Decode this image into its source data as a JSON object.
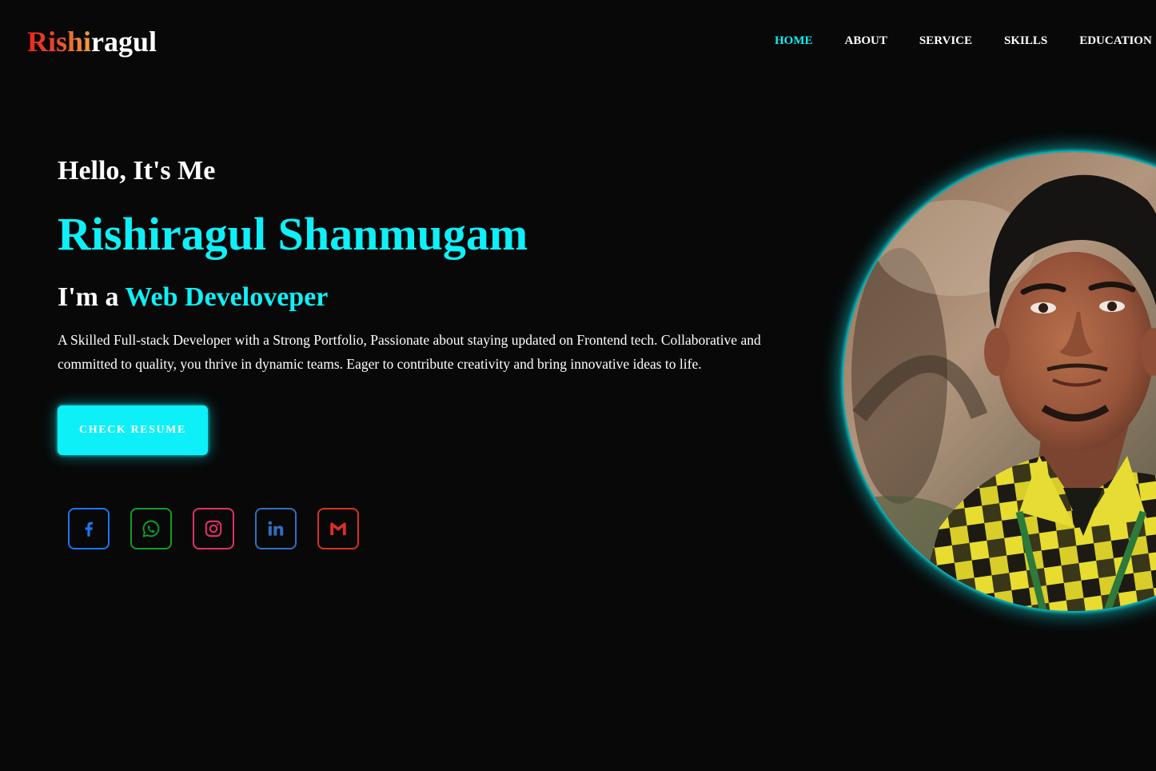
{
  "header": {
    "logo_first": "Rishi",
    "logo_second": "ragul",
    "nav": [
      "HOME",
      "ABOUT",
      "SERVICE",
      "SKILLS",
      "EDUCATION"
    ],
    "active_nav": "HOME"
  },
  "hero": {
    "greeting": "Hello, It's Me",
    "name": "Rishiragul Shanmugam",
    "role_prefix": "I'm a ",
    "role_highlight": "Web Develoveper",
    "description": "A Skilled Full-stack Developer with a Strong Portfolio, Passionate about staying updated on Frontend tech. Collaborative and committed to quality, you thrive in dynamic teams. Eager to contribute creativity and bring innovative ideas to life.",
    "resume_button": "CHECK RESUME"
  },
  "socials": [
    {
      "icon": "facebook-icon",
      "color": "#1877f2"
    },
    {
      "icon": "whatsapp-icon",
      "color": "#0f9d28"
    },
    {
      "icon": "instagram-icon",
      "color": "#e1306c"
    },
    {
      "icon": "linkedin-icon",
      "color": "#2f6fc4"
    },
    {
      "icon": "gmail-icon",
      "color": "#d93025"
    }
  ],
  "colors": {
    "accent": "#0ef0f7",
    "background": "#080808",
    "logo_gradient_start": "#e8291c",
    "logo_gradient_end": "#f0a13a"
  },
  "portrait": {
    "icon": "profile-photo"
  }
}
